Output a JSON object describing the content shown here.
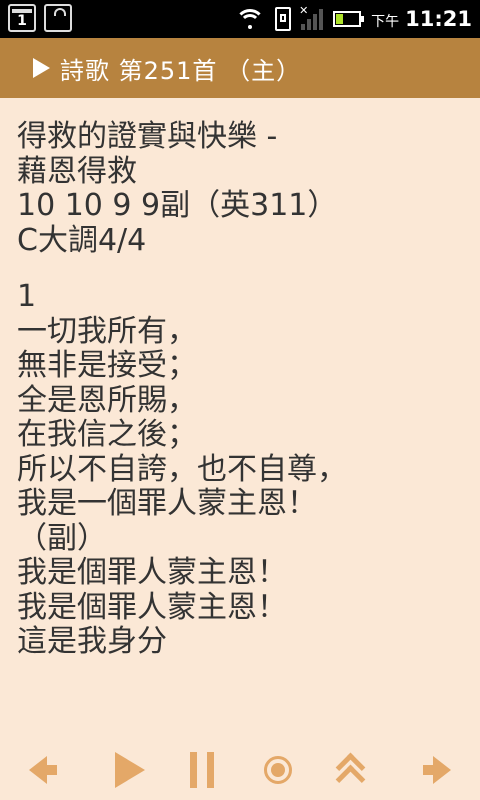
{
  "status_bar": {
    "calendar_day": "1",
    "ampm": "下午",
    "time": "11:21",
    "icons": [
      "calendar-icon",
      "shopping-bag-icon",
      "wifi-icon",
      "sim-icon",
      "signal-icon",
      "battery-icon"
    ]
  },
  "title_bar": {
    "title": "詩歌 第251首 （主）",
    "icon": "play-triangle-icon"
  },
  "hymn": {
    "header_lines": [
      "得救的證實與快樂 -",
      "藉恩得救",
      "10 10 9 9副（英311）",
      "C大調4/4"
    ],
    "verse_lines": [
      "1",
      "一切我所有，",
      "無非是接受；",
      "全是恩所賜，",
      "在我信之後；",
      "所以不自誇，也不自尊，",
      "我是一個罪人蒙主恩！",
      "（副）",
      "我是個罪人蒙主恩！",
      "我是個罪人蒙主恩！",
      "這是我身分"
    ]
  },
  "toolbar": {
    "buttons": [
      "previous",
      "play",
      "pause",
      "record",
      "scroll-up",
      "next"
    ]
  },
  "colors": {
    "background": "#fbe8d6",
    "title_bar": "#b7833f",
    "toolbar_icons": "#e4a868",
    "text": "#333333"
  }
}
